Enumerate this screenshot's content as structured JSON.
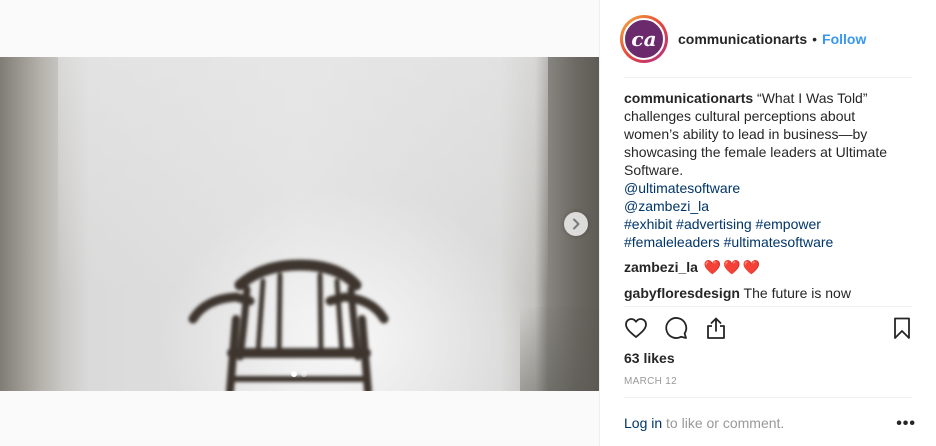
{
  "post": {
    "username": "communicationarts",
    "separator": "•",
    "follow_label": "Follow",
    "avatar_text": "ca",
    "caption_text": " “What I Was Told” challenges cultural perceptions about women’s ability to lead in business—by showcasing the female leaders at Ultimate Software.",
    "mentions": [
      "@ultimatesoftware",
      "@zambezi_la"
    ],
    "hashtags_line1": [
      "#exhibit",
      "#advertising",
      "#empower"
    ],
    "hashtags_line2": [
      "#femaleleaders",
      "#ultimatesoftware"
    ],
    "comments": [
      {
        "user": "zambezi_la",
        "text": "",
        "hearts": [
          "❤️",
          "❤️",
          "❤️"
        ]
      },
      {
        "user": "gabyfloresdesign",
        "text": " The future is now"
      }
    ],
    "likes": "63 likes",
    "date": "MARCH 12",
    "login_link": "Log in",
    "login_rest": " to like or comment.",
    "more_label": "•••"
  },
  "carousel": {
    "slide_count": 2,
    "active_index": 0
  },
  "icons": {
    "like": "heart-outline-icon",
    "comment": "comment-bubble-icon",
    "share": "share-upload-icon",
    "save": "bookmark-icon",
    "next": "chevron-right-icon"
  },
  "colors": {
    "link": "#003569",
    "follow": "#3897f0",
    "muted": "#999999",
    "heart": "#d8283e",
    "avatar_bg": "#6a2a6c"
  }
}
